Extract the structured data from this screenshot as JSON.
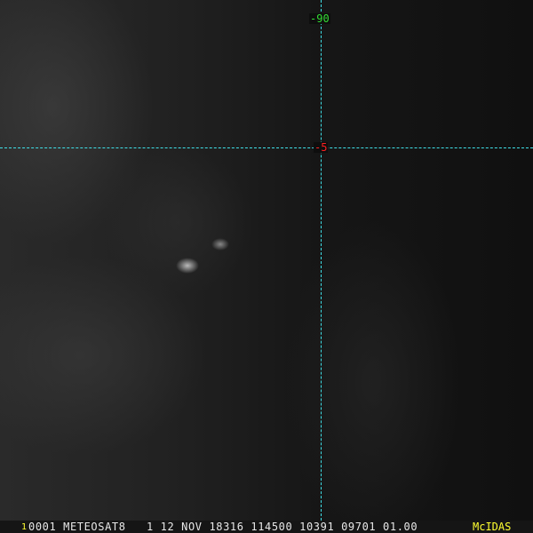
{
  "image": {
    "frame_number": "1",
    "info_line": "0001 METEOSAT8   1 12 NOV 18316 114500 10391 09701 01.00",
    "brand": "McIDAS",
    "grid": {
      "longitude_label": "-90",
      "latitude_label": "-5",
      "line_color": "#3fe0e8",
      "longitude_label_color": "#33dd33",
      "latitude_label_color": "#ff2020"
    }
  }
}
